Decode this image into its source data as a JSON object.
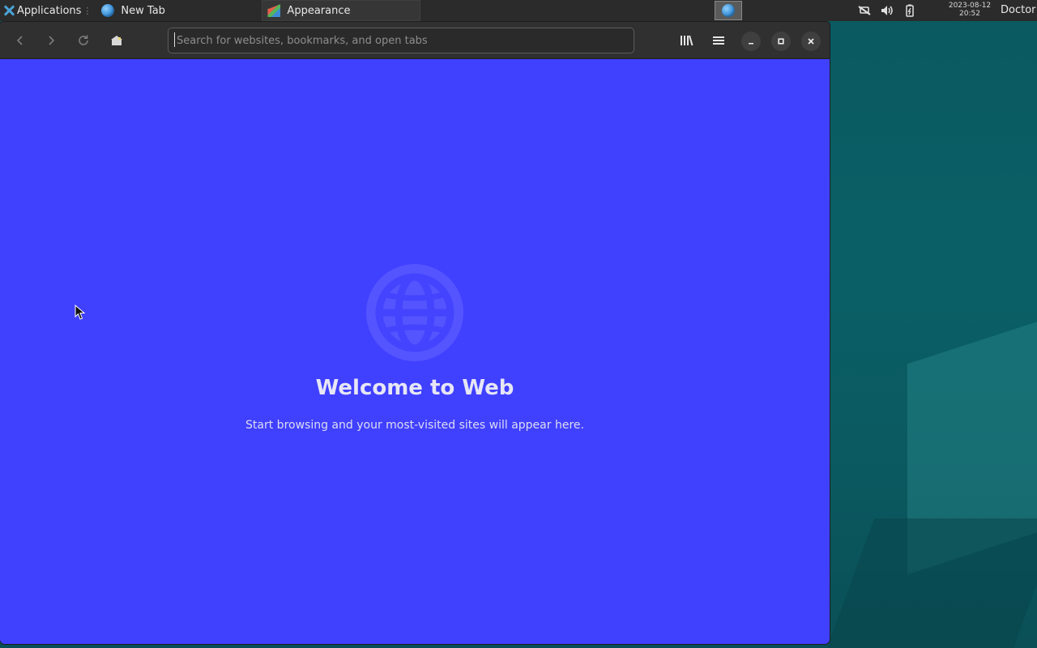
{
  "taskbar": {
    "app_menu_label": "Applications",
    "tasks": [
      {
        "label": "New Tab",
        "icon": "globe-icon"
      },
      {
        "label": "Appearance",
        "icon": "appearance-icon"
      }
    ],
    "tray_icons": [
      "network-icon",
      "volume-icon",
      "battery-icon"
    ],
    "clock_date": "2023-08-12",
    "clock_time": "20:52",
    "user": "Doctor"
  },
  "browser": {
    "search_placeholder": "Search for websites, bookmarks, and open tabs",
    "search_value": "",
    "welcome_title": "Welcome to Web",
    "welcome_subtitle": "Start browsing and your most-visited sites will appear here.",
    "accent_color": "#4040ff"
  }
}
